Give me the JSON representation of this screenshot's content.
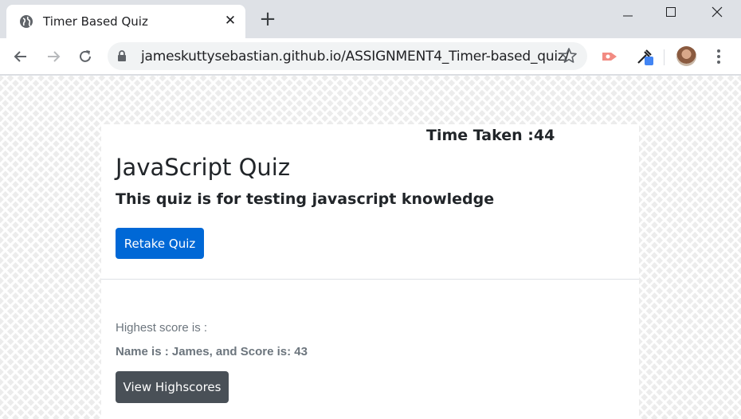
{
  "browser": {
    "tab": {
      "title": "Timer Based Quiz",
      "favicon": "globe-icon",
      "close_glyph": "✕"
    },
    "new_tab_glyph": "+",
    "address_bar": {
      "url": "jameskuttysebastian.github.io/ASSIGNMENT4_Timer-based_quiz/",
      "security_icon": "lock-icon"
    },
    "window_controls": [
      "minimize-icon",
      "maximize-icon",
      "close-icon"
    ]
  },
  "page": {
    "timer_text": "Time Taken :44",
    "title": "JavaScript Quiz",
    "subtitle": "This quiz is for testing javascript knowledge",
    "retake_button": "Retake Quiz",
    "highscore_label": "Highest score is :",
    "highscore_value": "Name is : James, and Score is: 43",
    "view_highscores_button": "View Highscores"
  },
  "colors": {
    "primary_button": "#0068d6",
    "secondary_button": "#495057",
    "muted_text": "#6c757d",
    "heading_text": "#212529"
  }
}
